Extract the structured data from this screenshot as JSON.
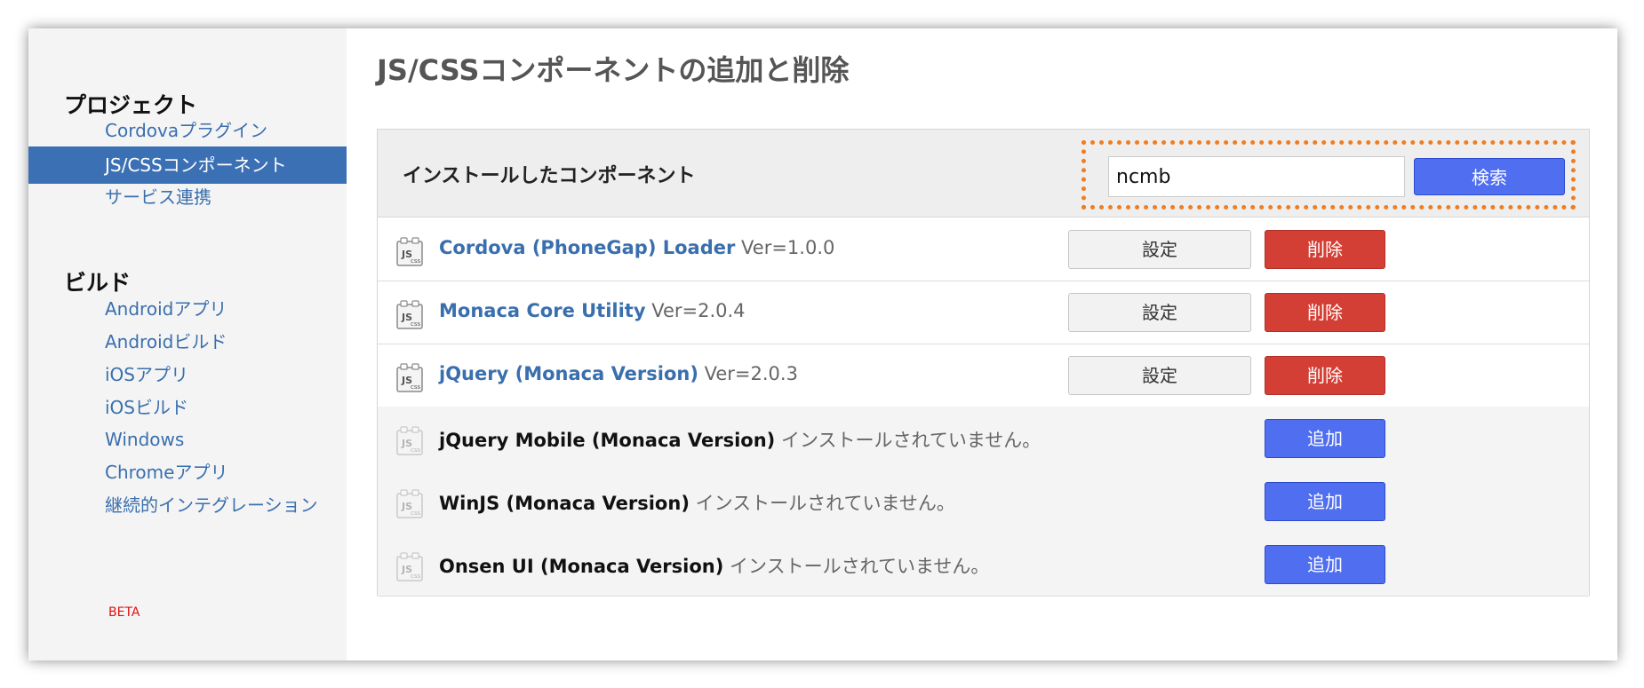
{
  "sidebar": {
    "sections": [
      {
        "title": "プロジェクト",
        "items": [
          {
            "label": "Cordovaプラグイン",
            "active": false
          },
          {
            "label": "JS/CSSコンポーネント",
            "active": true
          },
          {
            "label": "サービス連携",
            "active": false
          }
        ]
      },
      {
        "title": "ビルド",
        "items": [
          {
            "label": "Androidアプリ"
          },
          {
            "label": "Androidビルド"
          },
          {
            "label": "iOSアプリ"
          },
          {
            "label": "iOSビルド"
          },
          {
            "label": "Windows"
          },
          {
            "label": "Chromeアプリ"
          },
          {
            "label": "継続的インテグレーション",
            "badge": "BETA"
          }
        ]
      }
    ]
  },
  "main": {
    "title": "JS/CSSコンポーネントの追加と削除",
    "panel": {
      "header_title": "インストールしたコンポーネント",
      "search": {
        "value": "ncmb",
        "button_label": "検索"
      },
      "components": [
        {
          "name": "Cordova (PhoneGap) Loader",
          "status": "Ver=1.0.0",
          "installed": true,
          "settings_label": "設定",
          "delete_label": "削除"
        },
        {
          "name": "Monaca Core Utility",
          "status": "Ver=2.0.4",
          "installed": true,
          "settings_label": "設定",
          "delete_label": "削除"
        },
        {
          "name": "jQuery (Monaca Version)",
          "status": "Ver=2.0.3",
          "installed": true,
          "settings_label": "設定",
          "delete_label": "削除"
        },
        {
          "name": "jQuery Mobile (Monaca Version)",
          "status": "インストールされていません。",
          "installed": false,
          "add_label": "追加"
        },
        {
          "name": "WinJS (Monaca Version)",
          "status": "インストールされていません。",
          "installed": false,
          "add_label": "追加"
        },
        {
          "name": "Onsen UI (Monaca Version)",
          "status": "インストールされていません。",
          "installed": false,
          "add_label": "追加"
        }
      ]
    }
  },
  "colors": {
    "accent_blue": "#4f6ef0",
    "sidebar_active": "#3c70b4",
    "delete_red": "#d43f35",
    "highlight_orange": "#ef7d22",
    "link_blue": "#3a6fae"
  },
  "icons": {
    "component": "js-css-file-icon"
  }
}
